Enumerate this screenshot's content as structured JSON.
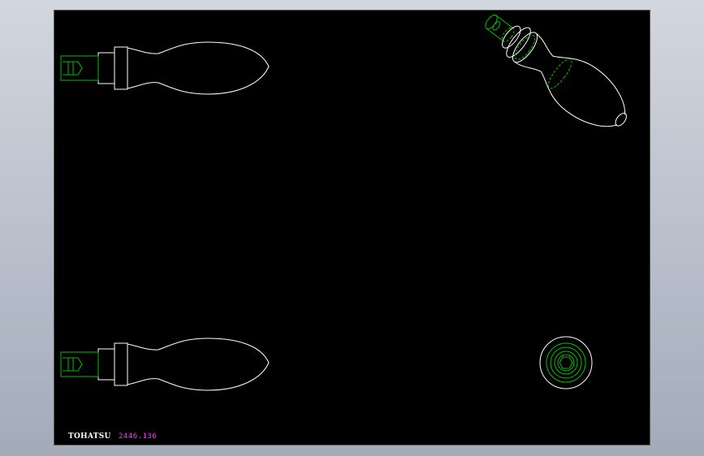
{
  "titleblock": {
    "brand": "TOHATSU",
    "code": "2446.136"
  },
  "colors": {
    "sheet_background": "#000000",
    "outline": "#ffffff",
    "hidden_detail": "#00c000",
    "code_text": "#ff33ff"
  },
  "views": [
    {
      "id": "side-view-top",
      "shape": "handle-profile"
    },
    {
      "id": "side-view-bottom",
      "shape": "handle-profile"
    },
    {
      "id": "isometric-view",
      "shape": "handle-3d"
    },
    {
      "id": "end-view",
      "shape": "circular-knob"
    }
  ]
}
